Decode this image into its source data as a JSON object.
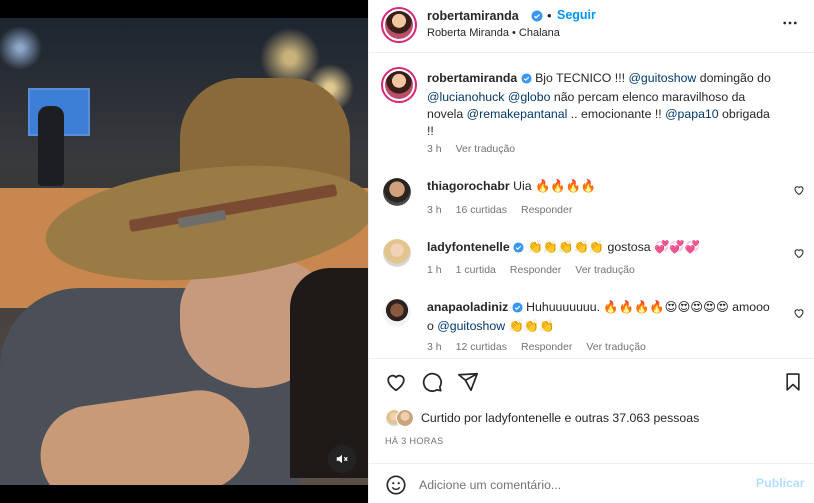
{
  "header": {
    "username": "robertamiranda",
    "follow_label": "Seguir",
    "dot": "•",
    "subtitle": "Roberta Miranda • Chalana"
  },
  "caption": {
    "username": "robertamiranda",
    "text_1": "Bjo TECNICO !!! ",
    "mention_1": "@guitoshow",
    "text_2": " domingão do ",
    "mention_2": "@lucianohuck",
    "text_3": " ",
    "mention_3": "@globo",
    "text_4": " não percam elenco maravilhoso da novela ",
    "mention_4": "@remakepantanal",
    "text_5": " .. emocionante !! ",
    "mention_5": "@papa10",
    "text_6": " obrigada !!",
    "time": "3 h",
    "translate": "Ver tradução"
  },
  "comments": [
    {
      "username": "thiagorochabr",
      "text": "Uia 🔥🔥🔥🔥",
      "time": "3 h",
      "likes": "16 curtidas",
      "reply": "Responder"
    },
    {
      "username": "ladyfontenelle",
      "text": "👏👏👏👏👏 gostosa 💞💞💞",
      "time": "1 h",
      "likes": "1 curtida",
      "reply": "Responder",
      "translate": "Ver tradução"
    },
    {
      "username": "anapaoladiniz",
      "text_1": "Huhuuuuuuu. 🔥🔥🔥🔥😍😍😍😍😍 amooo o ",
      "mention": "@guitoshow",
      "text_2": " 👏👏👏",
      "time": "3 h",
      "likes": "12 curtidas",
      "reply": "Responder",
      "translate": "Ver tradução"
    }
  ],
  "likes": {
    "prefix": "Curtido por ",
    "user": "ladyfontenelle",
    "middle": " e ",
    "others": "outras 37.063 pessoas"
  },
  "time_ago": "HÁ 3 HORAS",
  "add_comment": {
    "placeholder": "Adicione um comentário...",
    "publish_label": "Publicar"
  },
  "colors": {
    "link": "#0095f6",
    "mention": "#00376b",
    "verified": "#3897f0",
    "muted_text": "#737373"
  },
  "icons": [
    "verified-icon",
    "more-icon",
    "heart-icon",
    "comment-icon",
    "share-icon",
    "bookmark-icon",
    "emoji-icon",
    "mute-icon"
  ]
}
